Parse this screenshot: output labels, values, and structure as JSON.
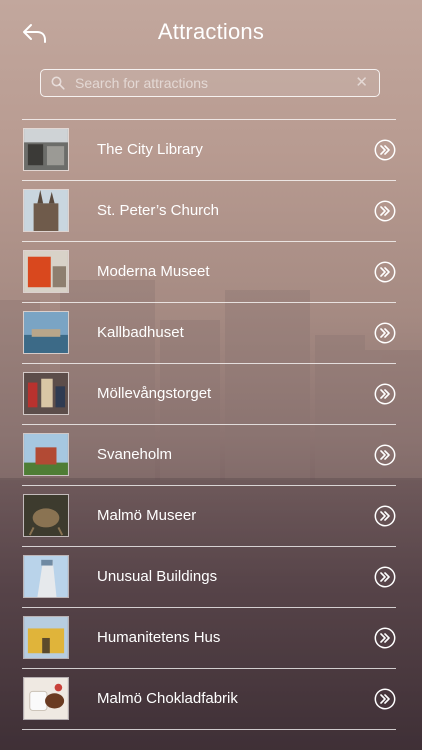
{
  "header": {
    "title": "Attractions",
    "back_icon": "back-arrow-icon"
  },
  "search": {
    "placeholder": "Search for attractions",
    "value": "",
    "clear_label": "✕"
  },
  "attractions": [
    {
      "name": "The City Library"
    },
    {
      "name": "St. Peter’s Church"
    },
    {
      "name": "Moderna Museet"
    },
    {
      "name": "Kallbadhuset"
    },
    {
      "name": "Möllevångstorget"
    },
    {
      "name": "Svaneholm"
    },
    {
      "name": "Malmö Museer"
    },
    {
      "name": "Unusual Buildings"
    },
    {
      "name": "Humanitetens Hus"
    },
    {
      "name": "Malmö Chokladfabrik"
    }
  ],
  "colors": {
    "text": "#ffffff",
    "background_top": "#c2a79d",
    "background_bottom": "#3f3036"
  }
}
